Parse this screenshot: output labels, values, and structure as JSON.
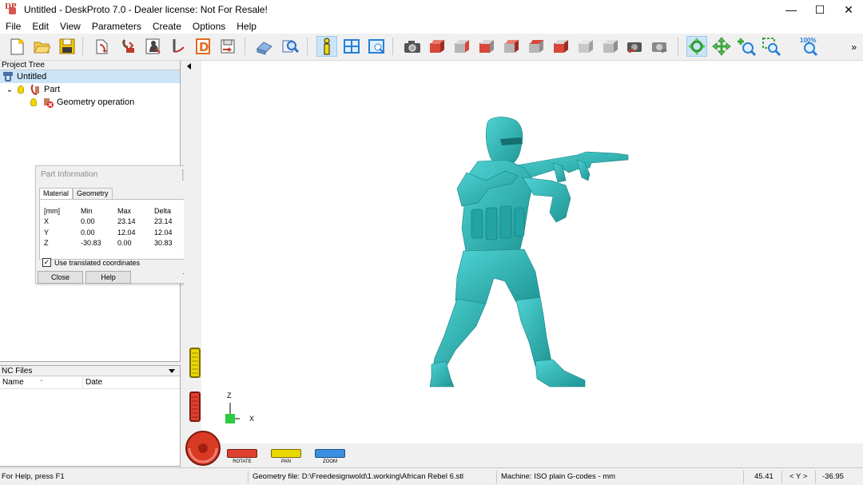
{
  "window": {
    "title": "Untitled - DeskProto 7.0 - Dealer license: Not For Resale!",
    "controls": {
      "minimize": "—",
      "maximize": "☐",
      "close": "✕"
    }
  },
  "menu": [
    "File",
    "Edit",
    "View",
    "Parameters",
    "Create",
    "Options",
    "Help"
  ],
  "toolbar": {
    "icons": [
      "new-file-icon",
      "open-folder-icon",
      "save-icon",
      "import-geometry-icon",
      "add-part-icon",
      "add-bitmap-icon",
      "add-vector-icon",
      "add-operation-icon",
      "export-icon",
      "preview-icon",
      "zoom-preview-icon",
      "info-icon",
      "layout-icon",
      "window-icon",
      "camera-icon",
      "view-front-icon",
      "view-back-icon",
      "view-left-icon",
      "view-right-icon",
      "view-top-icon",
      "view-bottom-icon",
      "view-iso-icon",
      "view-shaded-icon",
      "render-icon",
      "render-gray-icon",
      "rotate-tool-icon",
      "pan-tool-icon",
      "zoom-in-icon",
      "zoom-window-icon",
      "zoom-100-icon"
    ],
    "zoom_label": "100%",
    "overflow": "»"
  },
  "project_tree": {
    "header": "Project Tree",
    "root": "Untitled",
    "part": "Part",
    "operation": "Geometry operation",
    "expander": "⌄"
  },
  "part_info": {
    "title": "Part Information",
    "tabs": [
      "Material",
      "Geometry"
    ],
    "table_header": [
      "[mm]",
      "Min",
      "Max",
      "Delta"
    ],
    "rows": [
      [
        "X",
        "0.00",
        "23.14",
        "23.14"
      ],
      [
        "Y",
        "0.00",
        "12.04",
        "12.04"
      ],
      [
        "Z",
        "-30.83",
        "0.00",
        "30.83"
      ]
    ],
    "use_translated": "Use translated coordinates",
    "checkmark": "✓",
    "close": "Close",
    "help": "Help"
  },
  "nc_files": {
    "header": "NC Files",
    "col_name": "Name",
    "col_date": "Date",
    "sort_glyph": "⌄"
  },
  "viewport": {
    "model_color": "#33b8b8",
    "axis_z": "Z",
    "axis_x": "X",
    "mouse_modes": [
      "ROTATE",
      "PAN",
      "ZOOM"
    ]
  },
  "status": {
    "help": "For Help, press F1",
    "geometry": "Geometry file: D:\\Freedesignwold\\1.working\\African Rebel 6.stl",
    "machine": "Machine: ISO plain G-codes - mm",
    "x": "45.41",
    "axis": "< Y >",
    "y": "-36.95"
  }
}
